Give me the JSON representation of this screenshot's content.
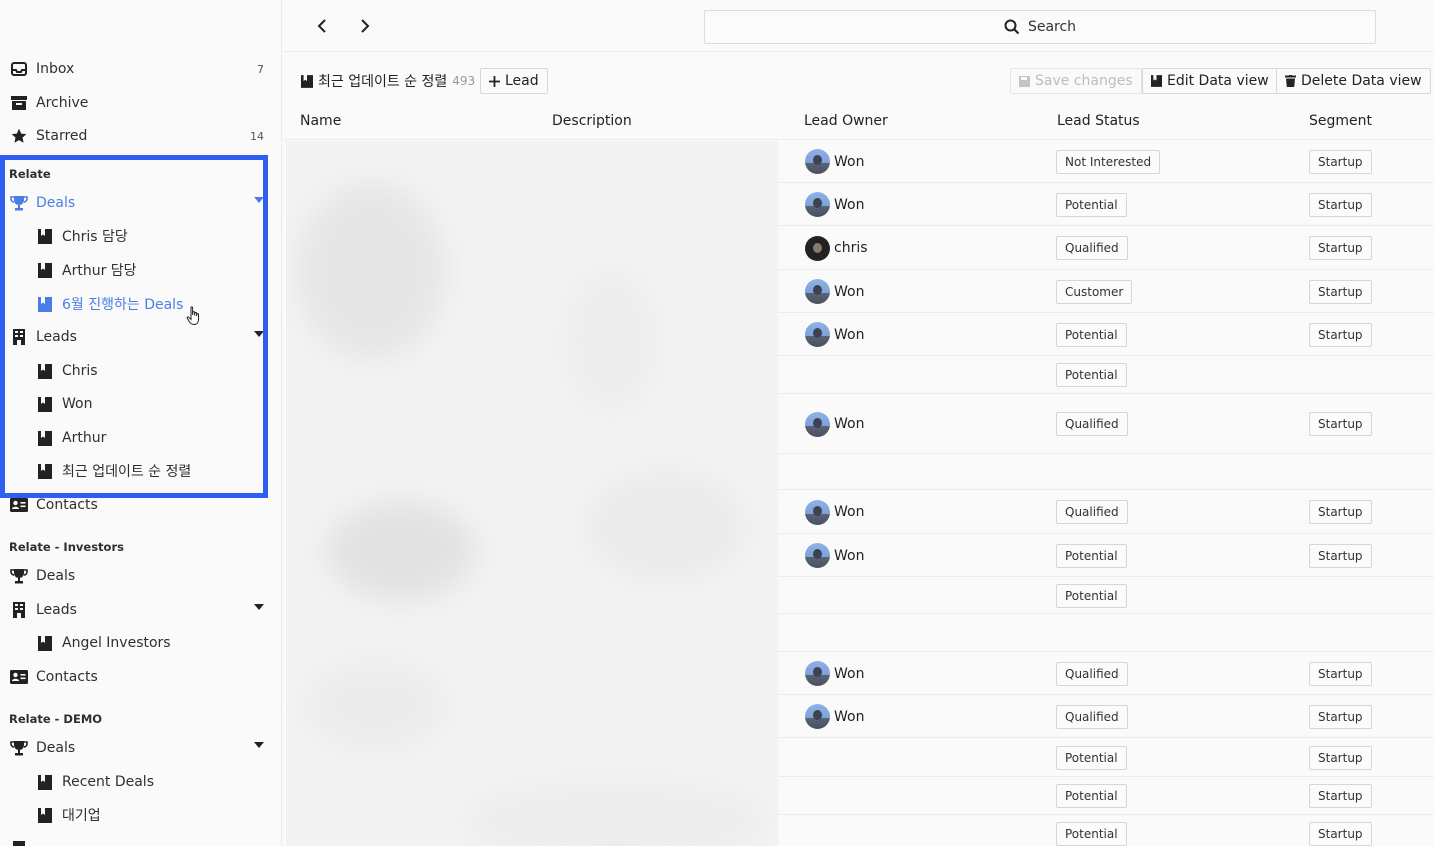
{
  "sidebar": {
    "top_items": [
      {
        "label": "Inbox",
        "count": "7",
        "icon": "inbox-icon"
      },
      {
        "label": "Archive",
        "icon": "archive-icon"
      },
      {
        "label": "Starred",
        "count": "14",
        "icon": "star-icon"
      }
    ],
    "sections": [
      {
        "title": "Relate",
        "deals": "Deals",
        "deal_views": [
          "Chris 담당",
          "Arthur 담당",
          "6월 진행하는 Deals"
        ],
        "leads": "Leads",
        "lead_views": [
          "Chris",
          "Won",
          "Arthur",
          "최근 업데이트 순 정렬"
        ],
        "contacts": "Contacts"
      },
      {
        "title": "Relate - Investors",
        "deals": "Deals",
        "leads": "Leads",
        "lead_views": [
          "Angel Investors"
        ],
        "contacts": "Contacts"
      },
      {
        "title": "Relate - DEMO",
        "deals": "Deals",
        "deal_views": [
          "Recent Deals",
          "대기업"
        ]
      }
    ],
    "highlight_color": "#2f5ef0",
    "active_color": "#4a7ee6"
  },
  "topbar": {
    "search_placeholder": "Search"
  },
  "toolbar": {
    "view_title": "최근 업데이트 순 정렬",
    "view_count": "493",
    "add_lead": "Lead",
    "save_changes": "Save changes",
    "edit_view": "Edit Data view",
    "delete_view": "Delete Data view"
  },
  "table": {
    "columns": [
      "Name",
      "Description",
      "Lead Owner",
      "Lead Status",
      "Segment"
    ],
    "rows": [
      {
        "owner": "Won",
        "avatar": "won",
        "status": "Not Interested",
        "segment": "Startup"
      },
      {
        "owner": "Won",
        "avatar": "won",
        "status": "Potential",
        "segment": "Startup"
      },
      {
        "owner": "chris",
        "avatar": "chris",
        "status": "Qualified",
        "segment": "Startup"
      },
      {
        "owner": "Won",
        "avatar": "won",
        "status": "Customer",
        "segment": "Startup"
      },
      {
        "owner": "Won",
        "avatar": "won",
        "status": "Potential",
        "segment": "Startup"
      },
      {
        "owner": "",
        "avatar": "",
        "status": "Potential",
        "segment": ""
      },
      {
        "owner": "Won",
        "avatar": "won",
        "status": "Qualified",
        "segment": "Startup"
      },
      {
        "owner": "",
        "avatar": "",
        "status": "",
        "segment": ""
      },
      {
        "owner": "Won",
        "avatar": "won",
        "status": "Qualified",
        "segment": "Startup"
      },
      {
        "owner": "Won",
        "avatar": "won",
        "status": "Potential",
        "segment": "Startup"
      },
      {
        "owner": "",
        "avatar": "",
        "status": "Potential",
        "segment": ""
      },
      {
        "owner": "",
        "avatar": "",
        "status": "",
        "segment": ""
      },
      {
        "owner": "Won",
        "avatar": "won",
        "status": "Qualified",
        "segment": "Startup"
      },
      {
        "owner": "Won",
        "avatar": "won",
        "status": "Qualified",
        "segment": "Startup"
      },
      {
        "owner": "",
        "avatar": "",
        "status": "Potential",
        "segment": "Startup"
      },
      {
        "owner": "",
        "avatar": "",
        "status": "Potential",
        "segment": "Startup"
      },
      {
        "owner": "",
        "avatar": "",
        "status": "Potential",
        "segment": "Startup"
      }
    ]
  }
}
